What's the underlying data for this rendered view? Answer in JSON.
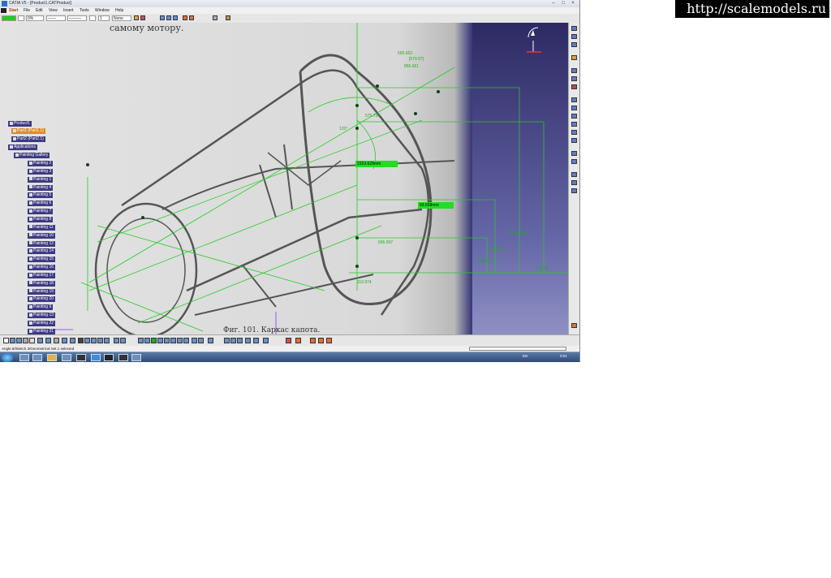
{
  "watermark": "http://scalemodels.ru",
  "window": {
    "title": "CATIA V5 - [Product1.CATProduct]",
    "controls": [
      "–",
      "□",
      "×"
    ]
  },
  "menu": {
    "items": [
      "Start",
      "File",
      "Edit",
      "View",
      "Insert",
      "Tools",
      "Window",
      "Help"
    ]
  },
  "toolbar_top": {
    "opacity_value": "0%",
    "line_type_value": "——",
    "line_weight_value": "———",
    "layer_value": "1",
    "render_value": "None"
  },
  "scan_texts": {
    "header": "самому мотору.",
    "caption": "Фиг. 101. Каркас капота."
  },
  "tree": {
    "root": "Product1",
    "part1": "Part1 (Part1.1)",
    "part2": "Part2 (Part2.1)",
    "applications": "Applications",
    "gallery": "Painting Gallery",
    "paintings": [
      "Painting 2",
      "Painting 3",
      "Painting 1",
      "Painting 4",
      "Painting 5",
      "Painting 6",
      "Painting 7",
      "Painting 8",
      "Painting 11",
      "Painting 10",
      "Painting 12",
      "Painting 14",
      "Painting 15",
      "Painting 16",
      "Painting 17",
      "Painting 18",
      "Painting 19",
      "Painting 20",
      "Painting 9",
      "Painting 13",
      "Painting 22",
      "Painting 21"
    ]
  },
  "dimensions": {
    "green_label_1": "2323.628mm",
    "green_label_2": "93.658mm",
    "d1": "555.652",
    "d2": "[579.97]",
    "d3": "855.661",
    "d4": "575.736",
    "d5": "120°",
    "d6": "695.597",
    "d7": "[1037.496]",
    "d8": "[792.59]",
    "d9": "[494.91]",
    "d10": "(156.9)",
    "d11": "110.974"
  },
  "statusbar": {
    "text": "Angle.6/Sketch.3/Geometrical Set.1 selected"
  },
  "taskbar": {
    "lang": "EN",
    "time": "0:01"
  },
  "compass_label": "x  y  z"
}
